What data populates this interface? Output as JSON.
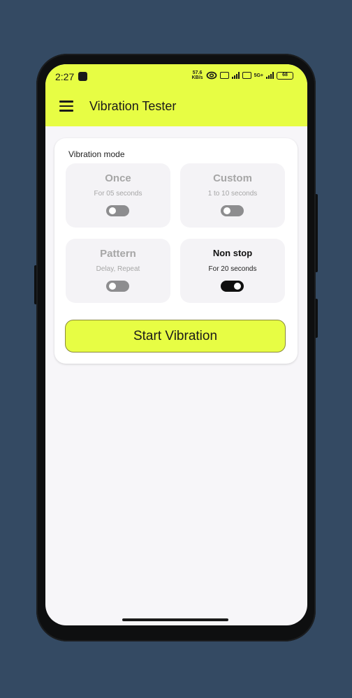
{
  "status_bar": {
    "time": "2:27",
    "net_speed_value": "57.6",
    "net_speed_unit": "KB/s",
    "network": "5G+",
    "battery": "68"
  },
  "app_bar": {
    "title": "Vibration Tester",
    "menu_icon": "hamburger-menu-icon",
    "background_color": "#e7fd44"
  },
  "vibration_mode": {
    "label": "Vibration mode",
    "modes": [
      {
        "title": "Once",
        "subtitle": "For 05 seconds",
        "enabled": false
      },
      {
        "title": "Custom",
        "subtitle": "1 to 10 seconds",
        "enabled": false
      },
      {
        "title": "Pattern",
        "subtitle": "Delay, Repeat",
        "enabled": false
      },
      {
        "title": "Non stop",
        "subtitle": "For 20 seconds",
        "enabled": true
      }
    ]
  },
  "start_button": {
    "label": "Start Vibration"
  }
}
